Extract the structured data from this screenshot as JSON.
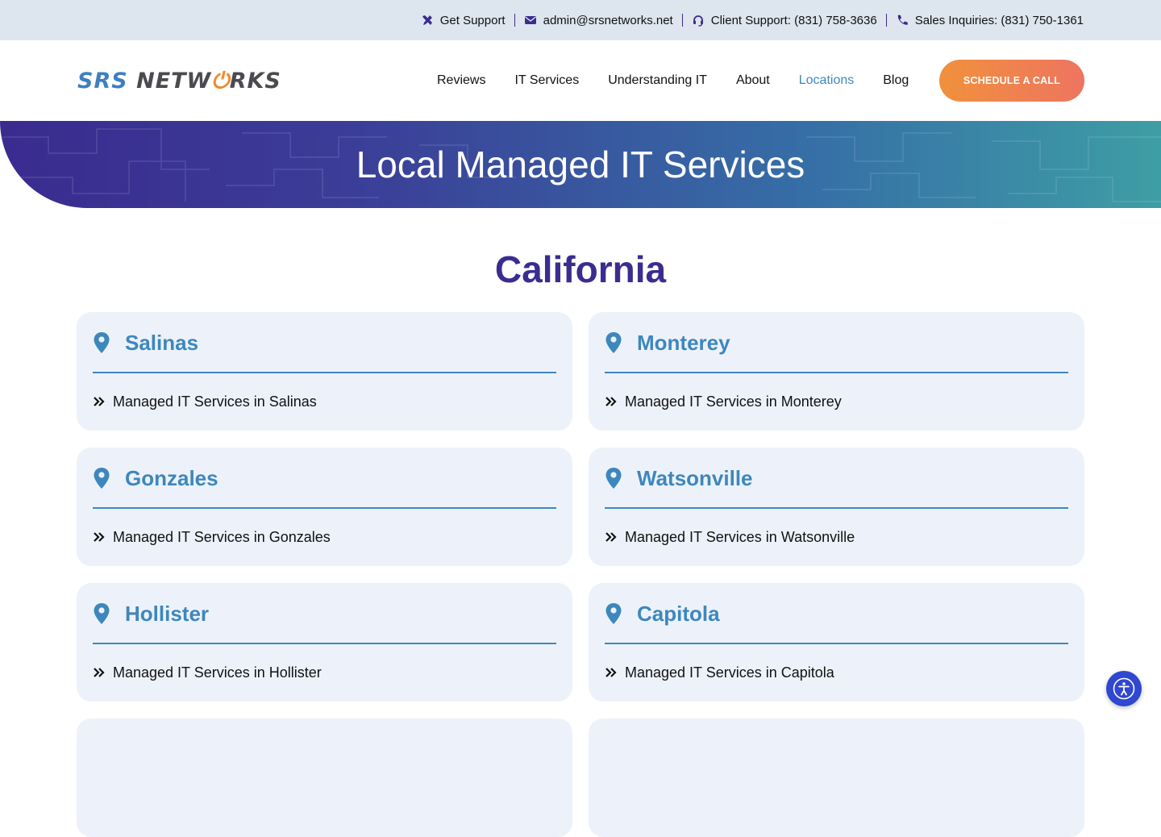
{
  "topbar": {
    "items": [
      {
        "label": "Get Support",
        "icon": "tools-icon"
      },
      {
        "label": "admin@srsnetworks.net",
        "icon": "envelope-icon"
      },
      {
        "label": "Client Support: (831) 758-3636",
        "icon": "headset-icon"
      },
      {
        "label": "Sales Inquiries: (831) 750-1361",
        "icon": "phone-icon"
      }
    ]
  },
  "header": {
    "logo": {
      "part1": "SRS ",
      "part2": "NETW",
      "part3": "⏻",
      "part4": "RKS"
    },
    "nav": [
      {
        "label": "Reviews",
        "active": false
      },
      {
        "label": "IT Services",
        "active": false
      },
      {
        "label": "Understanding IT",
        "active": false
      },
      {
        "label": "About",
        "active": false
      },
      {
        "label": "Locations",
        "active": true
      },
      {
        "label": "Blog",
        "active": false
      }
    ],
    "cta_label": "SCHEDULE A CALL"
  },
  "hero": {
    "title": "Local Managed IT Services"
  },
  "state": {
    "heading": "California"
  },
  "locations": [
    {
      "city": "Salinas",
      "link": "Managed IT Services in Salinas"
    },
    {
      "city": "Monterey",
      "link": "Managed IT Services in Monterey"
    },
    {
      "city": "Gonzales",
      "link": "Managed IT Services in Gonzales"
    },
    {
      "city": "Watsonville",
      "link": "Managed IT Services in Watsonville"
    },
    {
      "city": "Hollister",
      "link": "Managed IT Services in Hollister"
    },
    {
      "city": "Capitola",
      "link": "Managed IT Services in Capitola"
    }
  ],
  "colors": {
    "brand_purple": "#3a2d8f",
    "brand_blue": "#3e87bd",
    "accent_orange": "#f0913c",
    "card_bg": "#edf2fa",
    "topbar_bg": "#dde6ef"
  }
}
